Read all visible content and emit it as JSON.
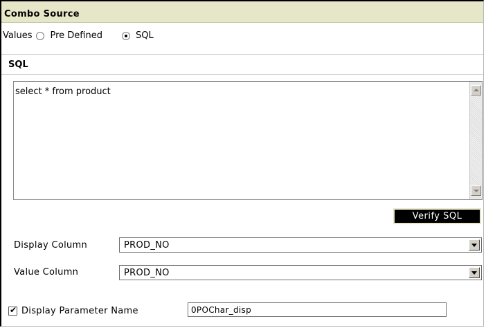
{
  "combo_source": {
    "title": "Combo Source",
    "values_label": "Values",
    "options": [
      {
        "label": "Pre Defined",
        "selected": false
      },
      {
        "label": "SQL",
        "selected": true
      }
    ]
  },
  "sql": {
    "title": "SQL",
    "query": "select * from product",
    "verify_label": "Verify SQL"
  },
  "display_column": {
    "label": "Display Column",
    "value": "PROD_NO"
  },
  "value_column": {
    "label": "Value Column",
    "value": "PROD_NO"
  },
  "display_parameter": {
    "checked": true,
    "label": "Display Parameter Name",
    "value": "0POChar_disp"
  },
  "colors": {
    "header_bg": "#e6e6c8",
    "button_bg": "#000000",
    "button_text": "#ffffff"
  }
}
